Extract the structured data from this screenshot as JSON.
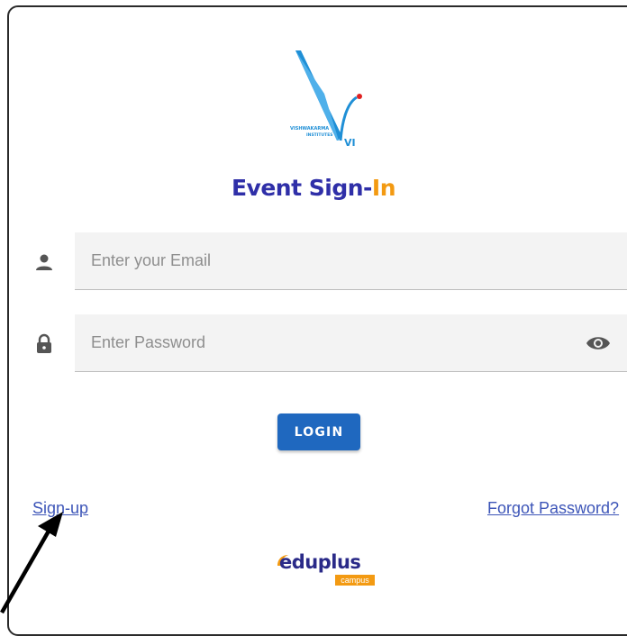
{
  "logo": {
    "letters": "VI",
    "institute_line1": "VISHWAKARMA",
    "institute_line2": "INSTITUTES",
    "colors": {
      "blue": "#1f8fd6",
      "red": "#e02020"
    }
  },
  "title": {
    "main": "Event Sign-",
    "accent": "In"
  },
  "email": {
    "icon": "person-icon",
    "placeholder": "Enter your Email",
    "value": ""
  },
  "password": {
    "icon": "lock-icon",
    "placeholder": "Enter Password",
    "value": "",
    "toggle_icon": "eye-icon"
  },
  "login": {
    "label": "LOGIN",
    "color": "#1f68bf"
  },
  "links": {
    "signup": "Sign-up",
    "forgot": "Forgot Password?"
  },
  "footer": {
    "brand": "eduplus",
    "sub": "campus",
    "brand_color": "#2a2a88",
    "accent_color": "#f39a12"
  },
  "annotation": {
    "icon": "arrow-icon"
  }
}
